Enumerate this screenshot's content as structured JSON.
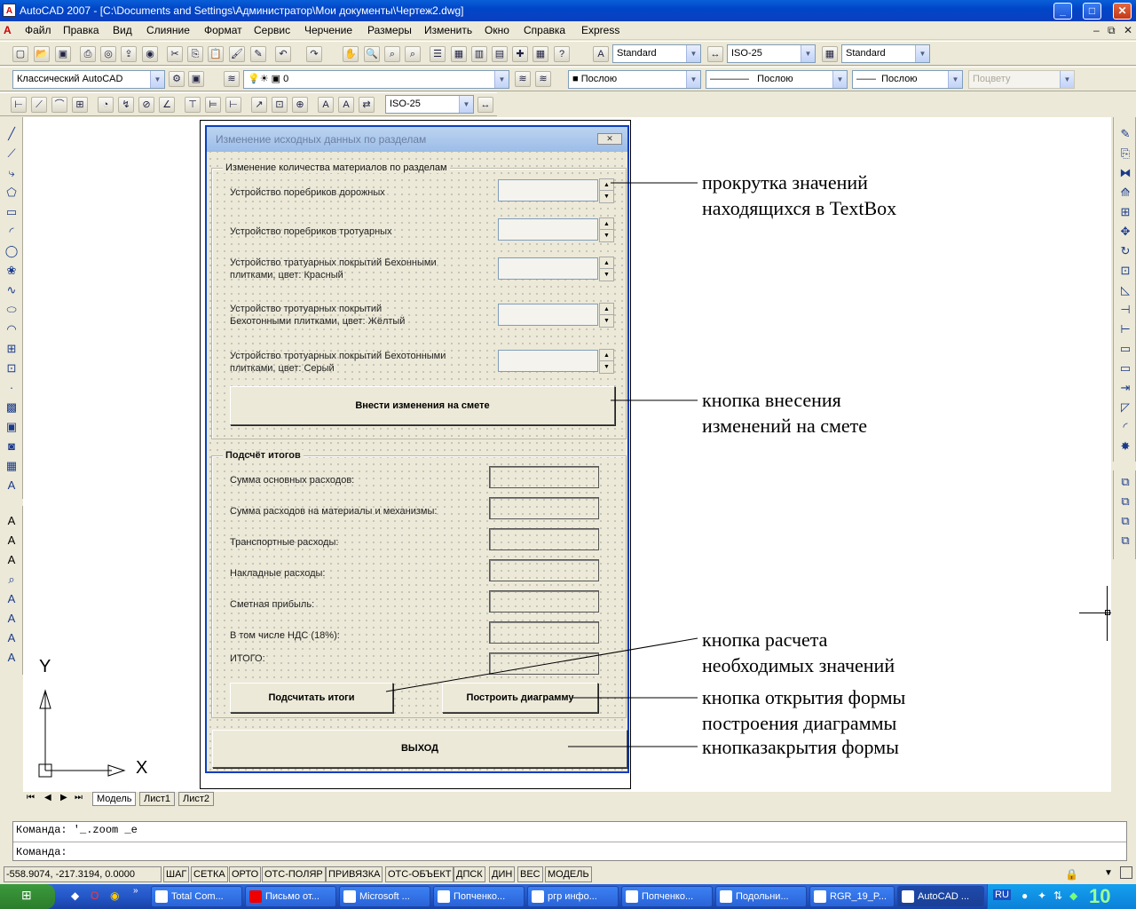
{
  "window": {
    "title": "AutoCAD 2007 - [C:\\Documents and Settings\\Администратор\\Мои документы\\Чертеж2.dwg]",
    "icon": "autocad-app-icon"
  },
  "menu": [
    "Файл",
    "Правка",
    "Вид",
    "Слияние",
    "Формат",
    "Сервис",
    "Черчение",
    "Размеры",
    "Изменить",
    "Окно",
    "Справка",
    "Express"
  ],
  "toolbar1": {
    "text_style": "Standard",
    "dim_style": "ISO-25",
    "table_style": "Standard"
  },
  "toolbar2": {
    "workspace": "Классический AutoCAD",
    "layer": "0",
    "color": "Послою",
    "linetype": "Послою",
    "lineweight": "Послою",
    "plotstyle": "Поцвету"
  },
  "toolbar3": {
    "dim_style": "ISO-25"
  },
  "form": {
    "title": "Изменение исходных данных по разделам",
    "frame1_caption": "Изменение количества материалов по разделам",
    "materials": [
      {
        "label": "Устройство поребриков дорожных"
      },
      {
        "label": "Устройство поребриков тротуарных"
      },
      {
        "label": "Устройство тратуарных покрытий Бехонными плитками, цвет: Красный"
      },
      {
        "label": "Устройство тротуарных покрытий Бехотонными плитками, цвет: Жёлтый"
      },
      {
        "label": "Устройство тротуарных покрытий Бехотонными плитками, цвет: Серый"
      }
    ],
    "apply_button": "Внести изменения на смете",
    "frame2_caption": "Подсчёт итогов",
    "totals": [
      {
        "label": "Сумма основных расходов:"
      },
      {
        "label": "Сумма расходов на материалы и механизмы:"
      },
      {
        "label": "Транспортные расходы:"
      },
      {
        "label": "Накладные расходы:"
      },
      {
        "label": "Сметная прибыль:"
      },
      {
        "label": "В том числе НДС (18%):"
      },
      {
        "label": "ИТОГО:"
      }
    ],
    "calc_button": "Подсчитать итоги",
    "chart_button": "Построить диаграмму",
    "exit_button": "ВЫХОД"
  },
  "annotations": {
    "a1": [
      "прокрутка значений",
      "находящихся в TextBox"
    ],
    "a2": [
      "кнопка внесения",
      "изменений на смете"
    ],
    "a3": [
      "кнопка расчета",
      "необходимых значений"
    ],
    "a4": [
      "кнопка открытия формы",
      "построения диаграммы"
    ],
    "a5": [
      "кнопказакрытия формы"
    ]
  },
  "ucs": {
    "x": "X",
    "y": "Y"
  },
  "layout_tabs": [
    "Модель",
    "Лист1",
    "Лист2"
  ],
  "command": {
    "line1": "Команда: '_.zoom _e",
    "line2": "Команда:"
  },
  "status": {
    "coords": "-558.9074, -217.3194, 0.0000",
    "buttons": [
      "ШАГ",
      "СЕТКА",
      "ОРТО",
      "ОТС-ПОЛЯР",
      "ПРИВЯЗКА",
      "ОТС-ОБЪЕКТ",
      "ДПСК",
      "ДИН",
      "ВЕС",
      "МОДЕЛЬ"
    ]
  },
  "taskbar": {
    "items": [
      "Total Com...",
      "Письмо от...",
      "Microsoft ...",
      "Попченко...",
      "ргр инфо...",
      "Попченко...",
      "Подольни...",
      "RGR_19_P...",
      "AutoCAD ..."
    ],
    "lang": "RU",
    "time": "10"
  }
}
